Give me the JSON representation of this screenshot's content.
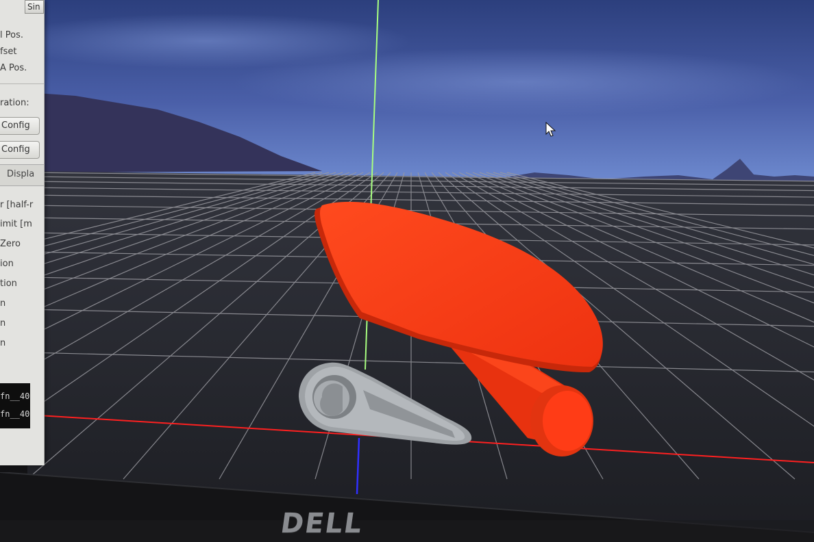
{
  "left_panel": {
    "top_button": "Sin",
    "labels": [
      "l Pos.",
      "fset",
      "A Pos.",
      "ration:",
      "r [half-r",
      "imit [m",
      " Zero",
      "ion",
      "tion",
      "n",
      "n",
      "n"
    ],
    "buttons": [
      "Config",
      "Config"
    ],
    "tab_label": "Displa",
    "console_lines": [
      "fn__40",
      "fn__40"
    ]
  },
  "viewport": {
    "sky_color": "#4a5fa8",
    "horizon_color": "#6a86cc",
    "ground_color": "#24252b",
    "grid_color": "#9a9aa0",
    "y_axis_color": "#a8ff80",
    "z_axis_color": "#3030ff",
    "x_axis_color": "#ff2020",
    "red_link_color": "#ff3a14",
    "gray_link_color": "#a8acb0"
  },
  "monitor": {
    "brand": "DELL"
  }
}
